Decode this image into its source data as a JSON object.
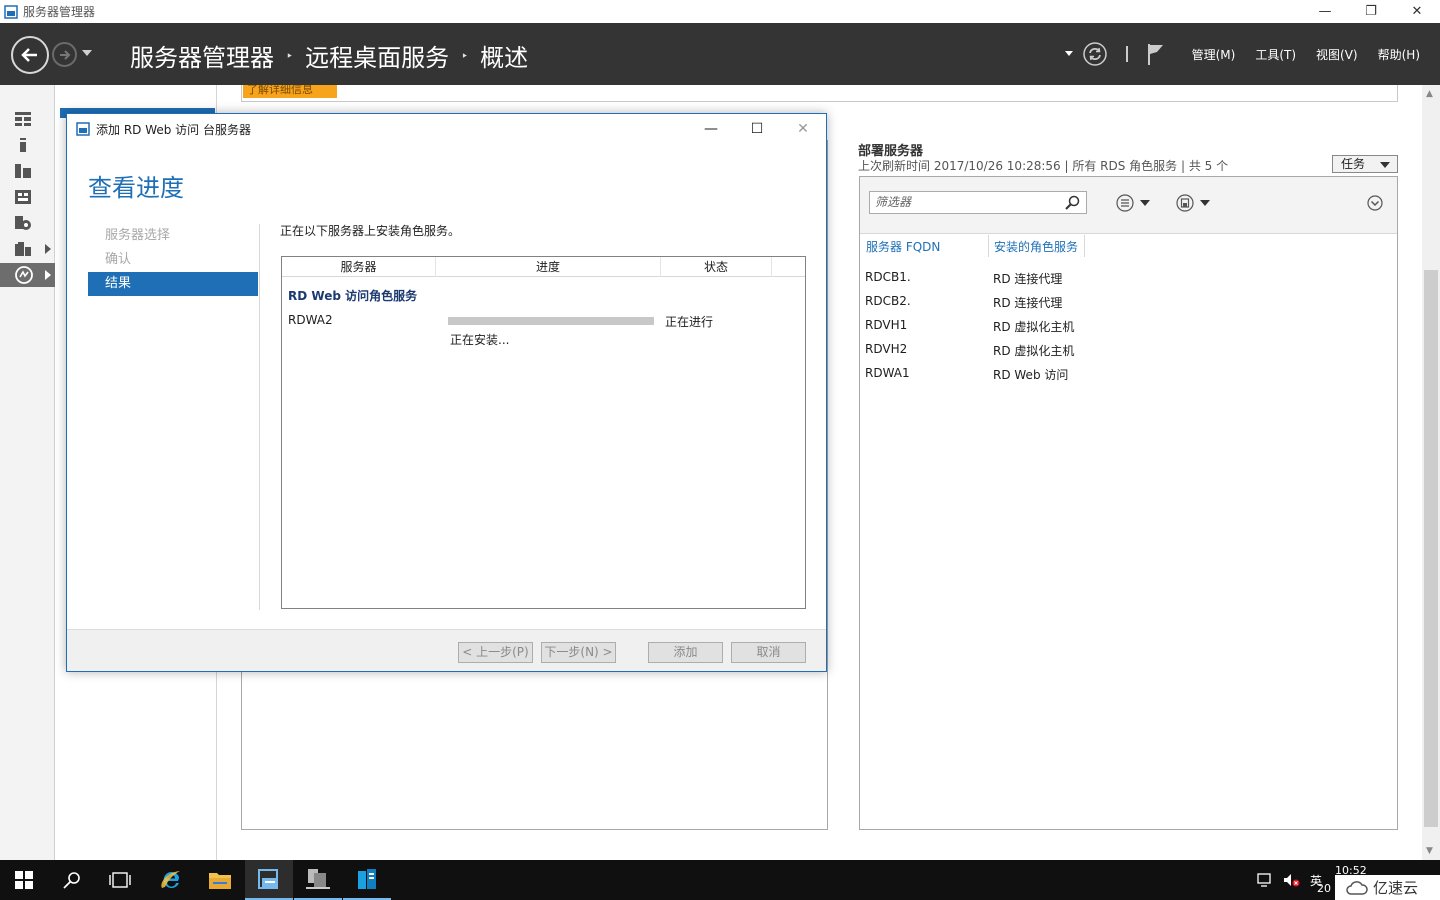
{
  "window": {
    "title": "服务器管理器",
    "minimize": "—",
    "restore": "❐",
    "close": "✕"
  },
  "header": {
    "breadcrumb": [
      "服务器管理器",
      "远程桌面服务",
      "概述"
    ],
    "separator": "‣",
    "menus": [
      "管理(M)",
      "工具(T)",
      "视图(V)",
      "帮助(H)"
    ]
  },
  "learn_more": "了解详细信息",
  "deployment": {
    "title": "部署服务器",
    "subtitle": "上次刷新时间 2017/10/26 10:28:56 | 所有 RDS 角色服务  | 共 5 个",
    "tasks_label": "任务",
    "filter_placeholder": "筛选器",
    "columns": [
      "服务器 FQDN",
      "安装的角色服务"
    ],
    "rows": [
      {
        "fqdn": "RDCB1.",
        "role": "RD 连接代理"
      },
      {
        "fqdn": "RDCB2.",
        "role": "RD 连接代理"
      },
      {
        "fqdn": "RDVH1",
        "role": "RD 虚拟化主机"
      },
      {
        "fqdn": "RDVH2",
        "role": "RD 虚拟化主机"
      },
      {
        "fqdn": "RDWA1",
        "role": "RD Web 访问"
      }
    ]
  },
  "dialog": {
    "title": "添加 RD Web 访问 台服务器",
    "minimize": "—",
    "maximize": "☐",
    "close": "✕",
    "heading": "查看进度",
    "steps": [
      {
        "label": "服务器选择",
        "active": false
      },
      {
        "label": "确认",
        "active": false
      },
      {
        "label": "结果",
        "active": true
      }
    ],
    "description": "正在以下服务器上安装角色服务。",
    "table": {
      "headers": [
        "服务器",
        "进度",
        "状态"
      ],
      "role_title": "RD Web 访问角色服务",
      "server": "RDWA2",
      "progress": 1.0,
      "status": "正在进行",
      "substatus": "正在安装..."
    },
    "buttons": {
      "prev": "< 上一步(P)",
      "next": "下一步(N) >",
      "add": "添加",
      "cancel": "取消"
    }
  },
  "taskbar": {
    "ime": "英",
    "time": "10:52",
    "date_partial": "20",
    "watermark": "亿速云"
  },
  "colors": {
    "accent": "#1e6fb5",
    "header_bg": "#343434",
    "learn_more": "#f7a31c"
  }
}
